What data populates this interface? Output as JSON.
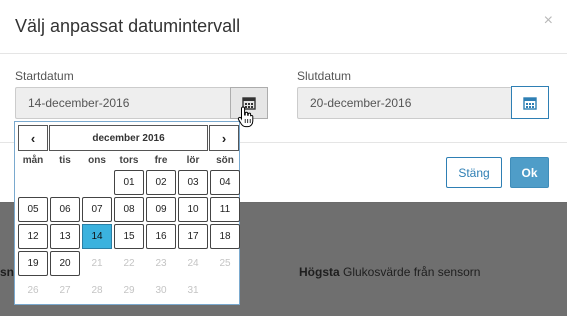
{
  "modal": {
    "title": "Välj anpassat datumintervall",
    "close_glyph": "×",
    "start_label": "Startdatum",
    "start_value": "14-december-2016",
    "end_label": "Slutdatum",
    "end_value": "20-december-2016",
    "close_button": "Stäng",
    "ok_button": "Ok"
  },
  "background": {
    "left_text": "sn",
    "right_bold": "Högsta",
    "right_text": " Glukosvärde från sensorn"
  },
  "datepicker": {
    "prev": "‹",
    "next": "›",
    "month": "december 2016",
    "weekdays": [
      "mån",
      "tis",
      "ons",
      "tors",
      "fre",
      "lör",
      "sön"
    ],
    "weeks": [
      [
        "",
        "",
        "",
        "01",
        "02",
        "03",
        "04"
      ],
      [
        "05",
        "06",
        "07",
        "08",
        "09",
        "10",
        "11"
      ],
      [
        "12",
        "13",
        "14",
        "15",
        "16",
        "17",
        "18"
      ],
      [
        "19",
        "20",
        "21",
        "22",
        "23",
        "24",
        "25"
      ],
      [
        "26",
        "27",
        "28",
        "29",
        "30",
        "31",
        ""
      ]
    ],
    "selected": "14",
    "last_enabled": "20"
  },
  "icons": {
    "calendar": "calendar-icon",
    "cursor": "hand-pointer-cursor"
  },
  "colors": {
    "accent": "#2e7fb4",
    "selected_day": "#3bb2de",
    "ok_button": "#4f9dc8"
  }
}
